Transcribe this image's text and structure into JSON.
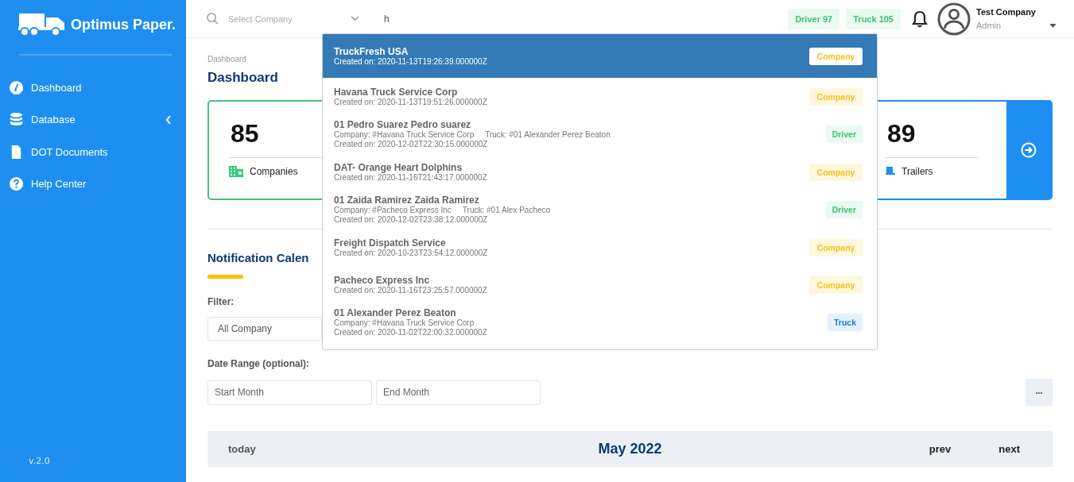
{
  "sidebar": {
    "logo_text": "Optimus Paper.",
    "items": [
      {
        "label": "Dashboard",
        "has_submenu": false
      },
      {
        "label": "Database",
        "has_submenu": true
      },
      {
        "label": "DOT Documents",
        "has_submenu": false
      },
      {
        "label": "Help Center",
        "has_submenu": false
      }
    ],
    "version": "v.2.0"
  },
  "header": {
    "company_select": {
      "placeholder": "Select Company"
    },
    "search": {
      "value": "h"
    },
    "counters": [
      {
        "label": "Driver 97"
      },
      {
        "label": "Truck 105"
      }
    ],
    "user": {
      "name": "Test Company",
      "role": "Admin"
    }
  },
  "breadcrumb": "Dashboard",
  "page_title": "Dashboard",
  "stats": [
    {
      "value": "85",
      "label": "Companies"
    },
    {
      "value": "89",
      "label": "Trailers"
    }
  ],
  "search_results": [
    {
      "title": "TruckFresh USA",
      "created": "Created on: 2020-11-13T19:26:39.000000Z",
      "type": "Company",
      "selected": true
    },
    {
      "title": "Havana Truck Service Corp",
      "created": "Created on: 2020-11-13T19:51:26.000000Z",
      "type": "Company",
      "selected": false
    },
    {
      "title": "01 Pedro Suarez Pedro suarez",
      "details": [
        "Company: #Havana Truck Service Corp",
        "Truck: #01 Alexander Perez Beaton"
      ],
      "created": "Created on: 2020-12-02T22:30:15.000000Z",
      "type": "Driver",
      "selected": false
    },
    {
      "title": "DAT- Orange Heart Dolphins",
      "created": "Created on: 2020-11-16T21:43:17.000000Z",
      "type": "Company",
      "selected": false
    },
    {
      "title": "01 Zaida Ramirez Zaida Ramirez",
      "details": [
        "Company: #Pacheco Express Inc",
        "Truck: #01 Alex Pacheco"
      ],
      "created": "Created on: 2020-12-02T23:38:12.000000Z",
      "type": "Driver",
      "selected": false
    },
    {
      "title": "Freight Dispatch Service",
      "created": "Created on: 2020-10-23T23:54:12.000000Z",
      "type": "Company",
      "selected": false
    },
    {
      "title": "Pacheco Express Inc",
      "created": "Created on: 2020-11-16T23:25:57.000000Z",
      "type": "Company",
      "selected": false
    },
    {
      "title": "01 Alexander Perez Beaton",
      "details": [
        "Company: #Havana Truck Service Corp"
      ],
      "created": "Created on: 2020-11-02T22:00:32.000000Z",
      "type": "Truck",
      "selected": false
    }
  ],
  "calendar_section": {
    "title": "Notification Calen",
    "filter_label": "Filter:",
    "filter_value": "All Company",
    "date_range_label": "Date Range (optional):",
    "start_placeholder": "Start Month",
    "end_placeholder": "End Month",
    "more_button": "•••",
    "toolbar": {
      "today": "today",
      "month": "May 2022",
      "prev": "prev",
      "next": "next"
    }
  }
}
